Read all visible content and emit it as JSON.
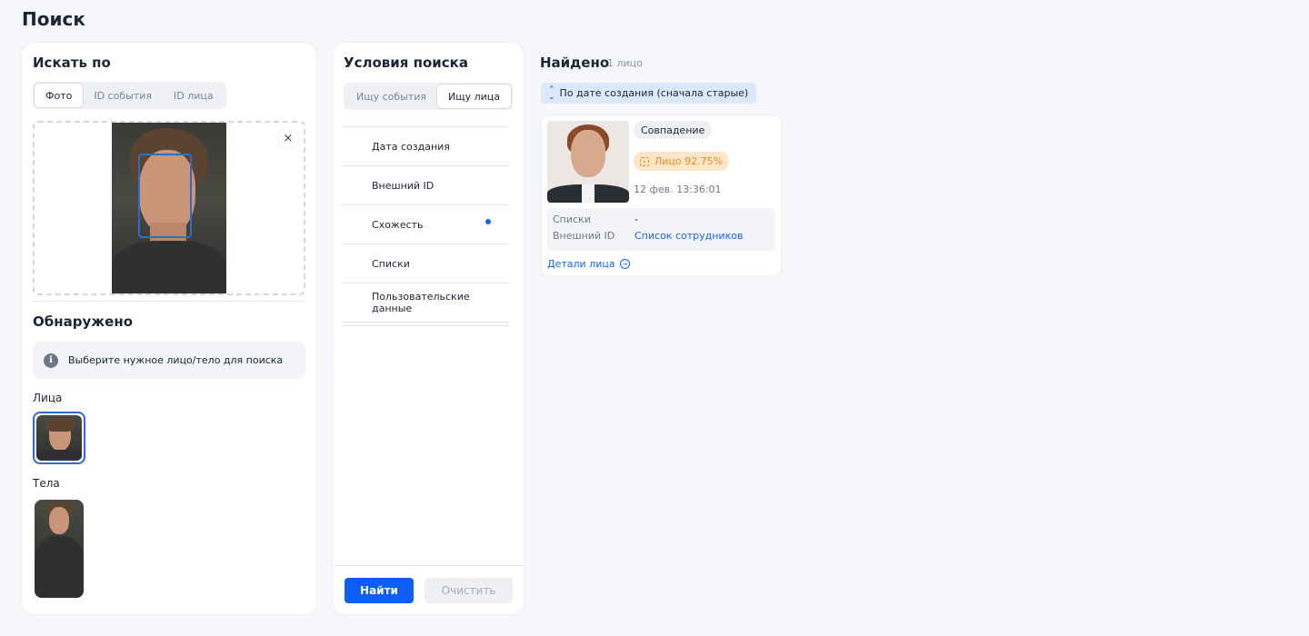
{
  "page": {
    "title": "Поиск"
  },
  "search_by": {
    "title": "Искать по",
    "tabs": [
      {
        "label": "Фото",
        "active": true
      },
      {
        "label": "ID события",
        "active": false
      },
      {
        "label": "ID лица",
        "active": false
      }
    ],
    "close_glyph": "×",
    "detected_title": "Обнаружено",
    "info_icon_glyph": "i",
    "info_text": "Выберите нужное лицо/тело для поиска",
    "faces_label": "Лица",
    "bodies_label": "Тела"
  },
  "conditions": {
    "title": "Условия поиска",
    "tabs": [
      {
        "label": "Ищу события",
        "active": false
      },
      {
        "label": "Ищу лица",
        "active": true
      }
    ],
    "items": [
      {
        "label": "Дата создания",
        "has_dot": false
      },
      {
        "label": "Внешний ID",
        "has_dot": false
      },
      {
        "label": "Схожесть",
        "has_dot": true
      },
      {
        "label": "Списки",
        "has_dot": false
      },
      {
        "label": "Пользовательские данные",
        "has_dot": false
      }
    ],
    "find_label": "Найти",
    "clear_label": "Очистить"
  },
  "results": {
    "title": "Найдено",
    "count": "1 лицо",
    "sort_label": "По дате создания (сначала старые)",
    "sort_icon_glyph": "⌃⌄",
    "card": {
      "match_label": "Совпадение",
      "score_label": "Лицо 92.75%",
      "date": "12 фев. 13:36:01",
      "lists_key": "Списки",
      "lists_value": "-",
      "external_id_key": "Внешний ID",
      "external_id_value": "Список сотрудников",
      "details_label": "Детали лица",
      "details_arrow_glyph": "→"
    }
  },
  "colors": {
    "accent": "#0d5ef5",
    "link": "#1565e8",
    "score_bg": "#fde6c7",
    "score_text": "#e08a1e",
    "sort_bg": "#dce8fb"
  }
}
